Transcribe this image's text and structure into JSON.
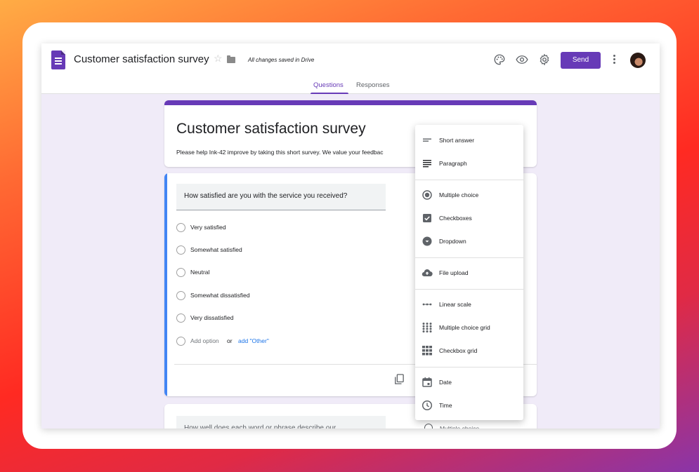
{
  "app": {
    "doc_title": "Customer satisfaction survey",
    "save_status": "All changes saved in Drive",
    "send_label": "Send",
    "icons": [
      "forms-logo-icon",
      "star-icon",
      "folder-icon",
      "palette-icon",
      "preview-eye-icon",
      "settings-gear-icon",
      "more-vert-icon",
      "avatar"
    ]
  },
  "tabs": [
    {
      "label": "Questions",
      "active": true
    },
    {
      "label": "Responses",
      "active": false
    }
  ],
  "form": {
    "title": "Customer satisfaction survey",
    "description": "Please help Ink-42 improve by taking this short survey. We value your feedbac"
  },
  "question1": {
    "text": "How satisfied are you with the service you received?",
    "options": [
      "Very satisfied",
      "Somewhat satisfied",
      "Neutral",
      "Somewhat dissatisfied",
      "Very dissatisfied"
    ],
    "add_option": "Add option",
    "or": "or",
    "add_other": "add \"Other\""
  },
  "question2": {
    "text": "How well does each word or phrase describe our",
    "type_peek": "Multiple choice"
  },
  "question_type_menu": {
    "groups": [
      [
        {
          "label": "Short answer",
          "icon": "short-text-icon"
        },
        {
          "label": "Paragraph",
          "icon": "paragraph-icon"
        }
      ],
      [
        {
          "label": "Multiple choice",
          "icon": "radio-button-icon"
        },
        {
          "label": "Checkboxes",
          "icon": "checkbox-icon"
        },
        {
          "label": "Dropdown",
          "icon": "dropdown-icon"
        }
      ],
      [
        {
          "label": "File upload",
          "icon": "cloud-upload-icon"
        }
      ],
      [
        {
          "label": "Linear scale",
          "icon": "linear-scale-icon"
        },
        {
          "label": "Multiple choice grid",
          "icon": "radio-grid-icon"
        },
        {
          "label": "Checkbox grid",
          "icon": "checkbox-grid-icon"
        }
      ],
      [
        {
          "label": "Date",
          "icon": "calendar-icon"
        },
        {
          "label": "Time",
          "icon": "clock-icon"
        }
      ]
    ]
  },
  "colors": {
    "brand": "#673ab7",
    "accent_blue": "#4285f4",
    "link": "#1a73e8",
    "canvas": "#f0ebf8"
  }
}
